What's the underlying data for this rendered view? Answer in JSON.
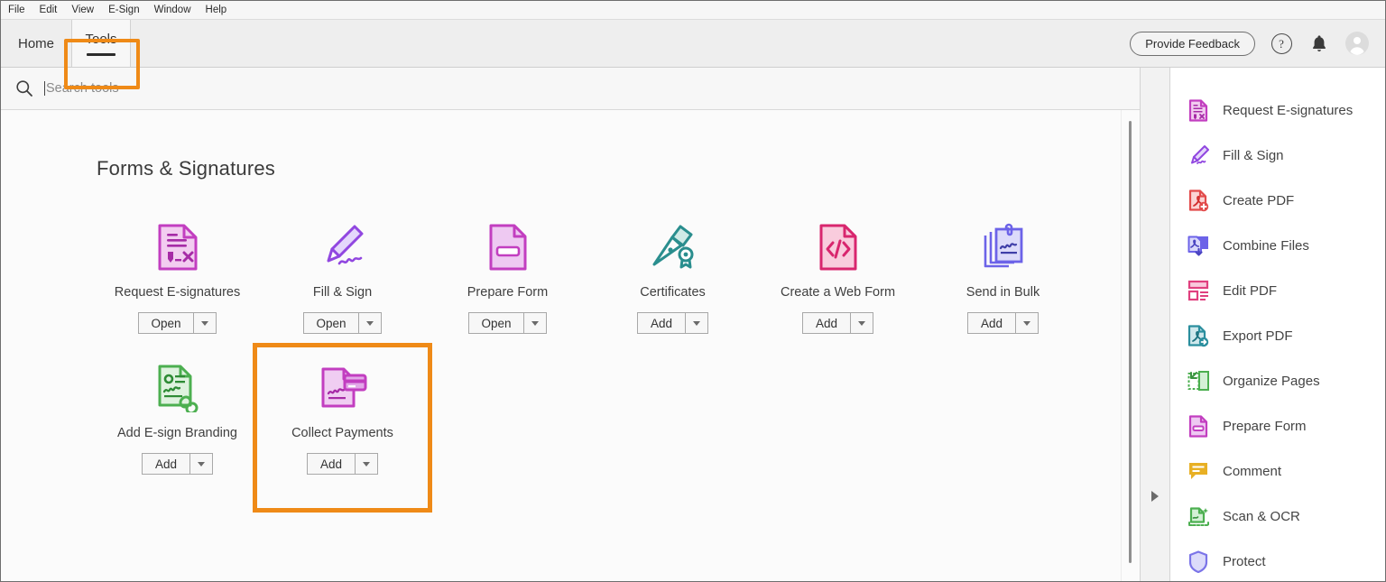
{
  "menubar": {
    "items": [
      {
        "label": "File"
      },
      {
        "label": "Edit"
      },
      {
        "label": "View"
      },
      {
        "label": "E-Sign"
      },
      {
        "label": "Window"
      },
      {
        "label": "Help"
      }
    ]
  },
  "tabs": {
    "home_label": "Home",
    "tools_label": "Tools",
    "active": "Tools"
  },
  "header": {
    "feedback_label": "Provide Feedback",
    "help_glyph": "?",
    "bell_icon": "bell-icon",
    "avatar_icon": "user-avatar-icon"
  },
  "search": {
    "placeholder": "Search tools",
    "value": "",
    "icon": "search-icon"
  },
  "main": {
    "section_title": "Forms & Signatures",
    "tiles": [
      {
        "label": "Request E-signatures",
        "action": "Open",
        "icon": "request-esignatures-icon",
        "selected": false
      },
      {
        "label": "Fill & Sign",
        "action": "Open",
        "icon": "fill-and-sign-icon",
        "selected": false
      },
      {
        "label": "Prepare Form",
        "action": "Open",
        "icon": "prepare-form-icon",
        "selected": false
      },
      {
        "label": "Certificates",
        "action": "Add",
        "icon": "certificates-icon",
        "selected": false
      },
      {
        "label": "Create a Web Form",
        "action": "Add",
        "icon": "create-web-form-icon",
        "selected": false
      },
      {
        "label": "Send in Bulk",
        "action": "Add",
        "icon": "send-in-bulk-icon",
        "selected": false
      },
      {
        "label": "Add E-sign Branding",
        "action": "Add",
        "icon": "add-esign-branding-icon",
        "selected": false
      },
      {
        "label": "Collect Payments",
        "action": "Add",
        "icon": "collect-payments-icon",
        "selected": true
      }
    ]
  },
  "right_rail": {
    "items": [
      {
        "label": "Request E-signatures",
        "icon": "request-esignatures-icon"
      },
      {
        "label": "Fill & Sign",
        "icon": "fill-and-sign-icon"
      },
      {
        "label": "Create PDF",
        "icon": "create-pdf-icon"
      },
      {
        "label": "Combine Files",
        "icon": "combine-files-icon"
      },
      {
        "label": "Edit PDF",
        "icon": "edit-pdf-icon"
      },
      {
        "label": "Export PDF",
        "icon": "export-pdf-icon"
      },
      {
        "label": "Organize Pages",
        "icon": "organize-pages-icon"
      },
      {
        "label": "Prepare Form",
        "icon": "prepare-form-icon"
      },
      {
        "label": "Comment",
        "icon": "comment-icon"
      },
      {
        "label": "Scan & OCR",
        "icon": "scan-ocr-icon"
      },
      {
        "label": "Protect",
        "icon": "protect-icon"
      }
    ]
  },
  "highlights": {
    "color": "#EF8A17",
    "targets": [
      "tools-tab",
      "collect-payments-tile"
    ]
  },
  "colors": {
    "accent_orange": "#EF8A17",
    "magenta": "#C0389F",
    "purple": "#A259DE",
    "violet": "#6C63E8",
    "teal": "#2A8E8E",
    "pink": "#D8266E",
    "green": "#4CAF50",
    "gold": "#E8B024",
    "tab_background": "#EEEEEE"
  }
}
